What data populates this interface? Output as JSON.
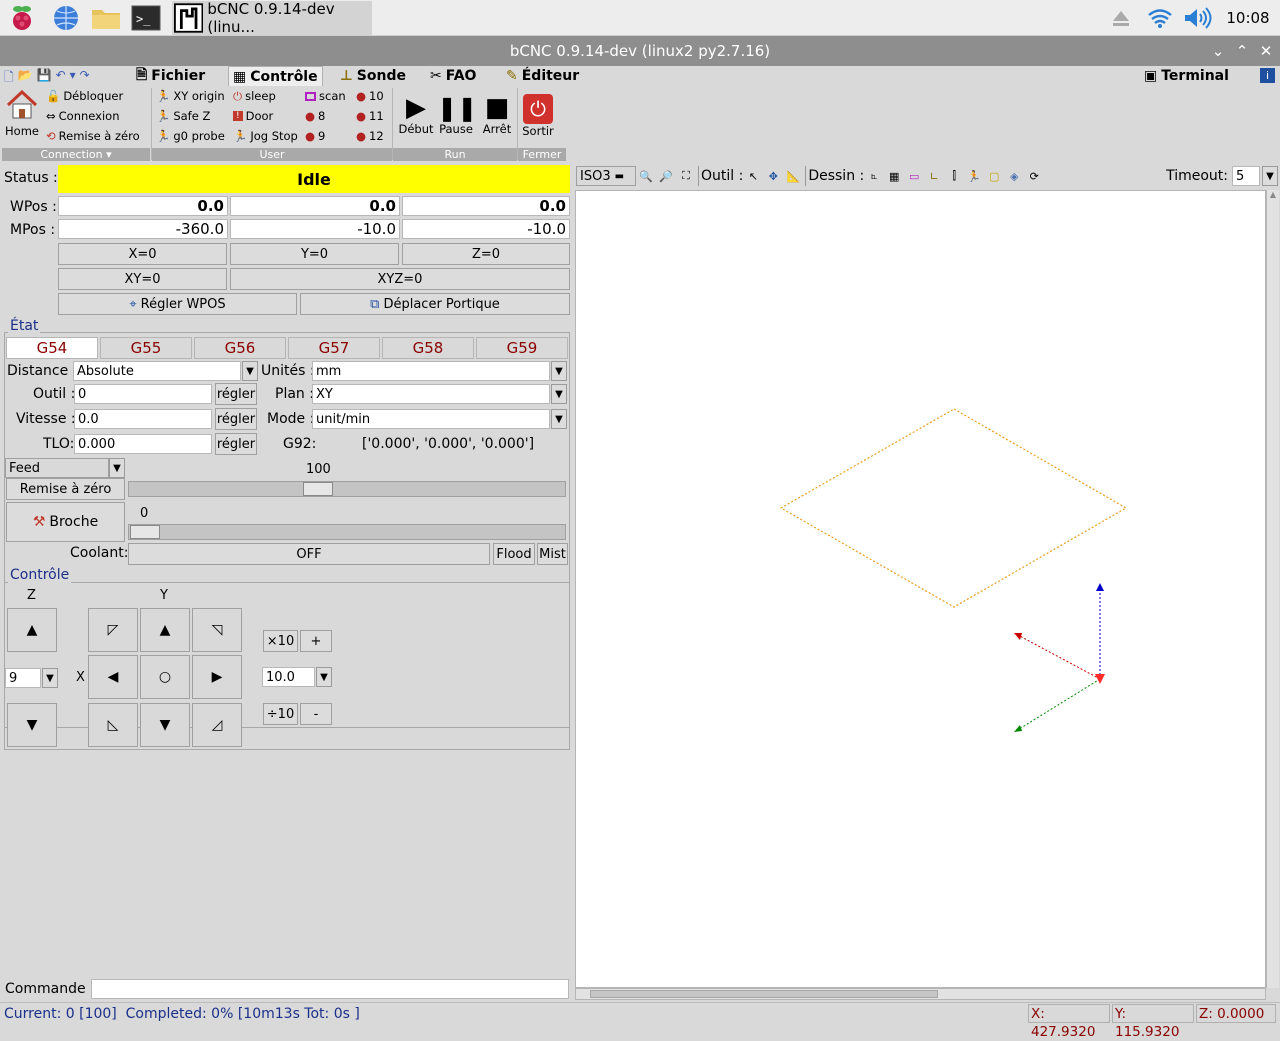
{
  "taskbar": {
    "window_label": "bCNC 0.9.14-dev (linu...",
    "clock": "10:08"
  },
  "window": {
    "title": "bCNC 0.9.14-dev (linux2 py2.7.16)"
  },
  "menu": {
    "fichier": "Fichier",
    "controle": "Contrôle",
    "sonde": "Sonde",
    "fao": "FAO",
    "editeur": "Éditeur",
    "terminal": "Terminal"
  },
  "ribbon": {
    "home": "Home",
    "unlock": "Débloquer",
    "connect": "Connexion",
    "reset": "Remise à zéro",
    "connection_group": "Connection",
    "xy_origin": "XY origin",
    "safe_z": "Safe Z",
    "g0_probe": "g0 probe",
    "sleep": "sleep",
    "door": "Door",
    "jog_stop": "Jog Stop",
    "scan": "scan",
    "b8": "8",
    "b9": "9",
    "b10": "10",
    "b11": "11",
    "b12": "12",
    "user_group": "User",
    "start": "Début",
    "pause": "Pause",
    "stop": "Arrêt",
    "run_group": "Run",
    "exit": "Sortir",
    "close_group": "Fermer"
  },
  "status": {
    "label": "Status :",
    "value": "Idle"
  },
  "wpos": {
    "label": "WPos :",
    "x": "0.0",
    "y": "0.0",
    "z": "0.0"
  },
  "mpos": {
    "label": "MPos :",
    "x": "-360.0",
    "y": "-10.0",
    "z": "-10.0"
  },
  "zero": {
    "x": "X=0",
    "y": "Y=0",
    "z": "Z=0",
    "xy": "XY=0",
    "xyz": "XYZ=0",
    "set_wpos": "Régler WPOS",
    "move_gantry": "Déplacer Portique"
  },
  "etat": {
    "title": "État",
    "tabs": [
      "G54",
      "G55",
      "G56",
      "G57",
      "G58",
      "G59"
    ],
    "distance_label": "Distance :",
    "distance": "Absolute",
    "units_label": "Unités :",
    "units": "mm",
    "tool_label": "Outil :",
    "tool": "0",
    "set": "régler",
    "plane_label": "Plan :",
    "plane": "XY",
    "feed_label": "Vitesse :",
    "feed": "0.0",
    "mode_label": "Mode :",
    "mode": "unit/min",
    "tlo_label": "TLO:",
    "tlo": "0.000",
    "g92_label": "G92:",
    "g92": "['0.000', '0.000', '0.000']",
    "override": "Feed",
    "override_value": "100",
    "reset_zero": "Remise à zéro",
    "spindle": "Broche",
    "spindle_value": "0",
    "coolant_label": "Coolant:",
    "coolant": "OFF",
    "flood": "Flood",
    "mist": "Mist"
  },
  "control": {
    "title": "Contrôle",
    "z": "Z",
    "y": "Y",
    "x": "X",
    "z_step": "9",
    "times10": "×10",
    "plus": "+",
    "step": "10.0",
    "div10": "÷10",
    "minus": "-"
  },
  "canvas": {
    "view": "ISO3",
    "tool_label": "Outil :",
    "draw_label": "Dessin :",
    "timeout_label": "Timeout:",
    "timeout": "5"
  },
  "command": {
    "label": "Commande :"
  },
  "statusbar": {
    "progress": "Current: 0 [100]  Completed: 0% [10m13s Tot: 0s ]",
    "x": "X: 427.9320",
    "y": "Y: 115.9320",
    "z": "Z: 0.0000"
  },
  "colors": {
    "accent": "#ffff00",
    "tab_text": "#8b0000",
    "frame_title": "#1a2f8a"
  }
}
